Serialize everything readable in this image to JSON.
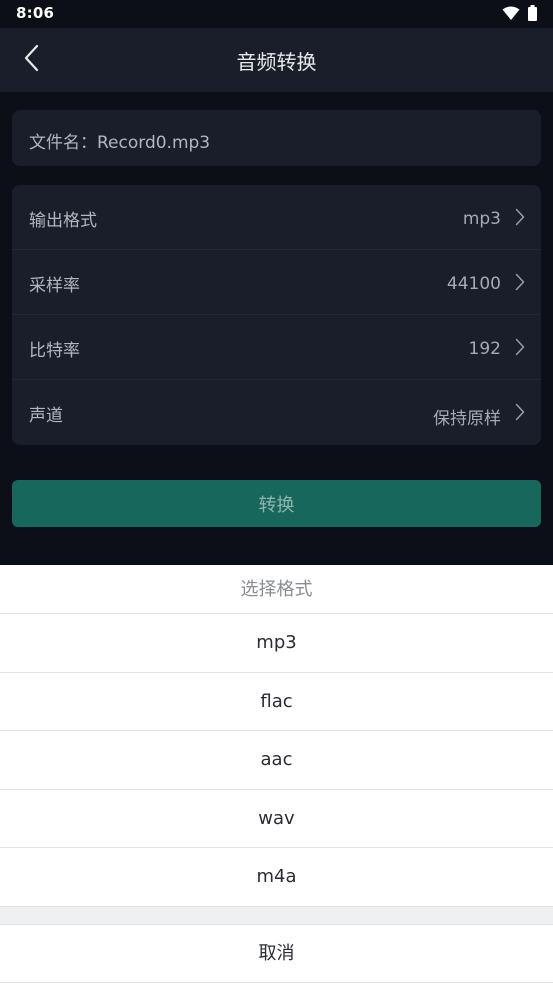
{
  "status_bar": {
    "time": "8:06",
    "icons": [
      "wifi-icon",
      "battery-icon"
    ]
  },
  "toolbar": {
    "back_icon": "chevron-left-icon",
    "title": "音频转换"
  },
  "file": {
    "name_text": "文件名：Record0.mp3"
  },
  "settings": {
    "rows": [
      {
        "label": "输出格式",
        "value": "mp3"
      },
      {
        "label": "采样率",
        "value": "44100"
      },
      {
        "label": "比特率",
        "value": "192"
      },
      {
        "label": "声道",
        "value": "保持原样"
      }
    ]
  },
  "convert_button": {
    "label": "转换"
  },
  "sheet": {
    "title": "选择格式",
    "options": [
      "mp3",
      "flac",
      "aac",
      "wav",
      "m4a"
    ],
    "cancel_label": "取消"
  },
  "colors": {
    "background": "#0c0f18",
    "card": "#1a1e2a",
    "accent": "#17675d",
    "sheet": "#ffffff"
  }
}
